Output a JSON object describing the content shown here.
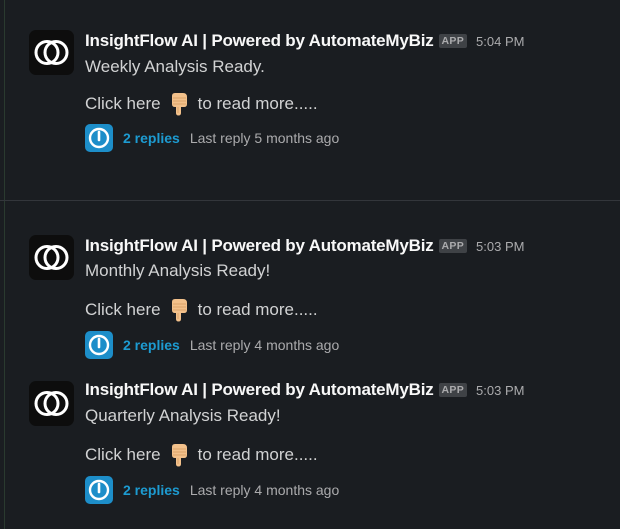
{
  "messages": [
    {
      "sender": "InsightFlow AI | Powered by AutomateMyBiz",
      "badge": "APP",
      "time": "5:04 PM",
      "text": "Weekly Analysis Ready.",
      "link_before": "Click here",
      "link_after": "to read more.....",
      "replies": "2 replies",
      "last_reply": "Last reply 5 months ago"
    },
    {
      "sender": "InsightFlow AI | Powered by AutomateMyBiz",
      "badge": "APP",
      "time": "5:03 PM",
      "text": "Monthly Analysis Ready!",
      "link_before": "Click here",
      "link_after": "to read more.....",
      "replies": "2 replies",
      "last_reply": "Last reply 4 months ago"
    },
    {
      "sender": "InsightFlow AI | Powered by AutomateMyBiz",
      "badge": "APP",
      "time": "5:03 PM",
      "text": "Quarterly Analysis Ready!",
      "link_before": "Click here",
      "link_after": "to read more.....",
      "replies": "2 replies",
      "last_reply": "Last reply 4 months ago"
    }
  ],
  "icons": {
    "avatar": "interlocking-rings-logo-icon",
    "hand": "backhand-index-pointing-down-emoji",
    "thread_avatar": "power-button-icon"
  },
  "colors": {
    "background": "#1a1d21",
    "link": "#1d9bd1",
    "thread_avatar_bg": "#1d8ec9"
  }
}
